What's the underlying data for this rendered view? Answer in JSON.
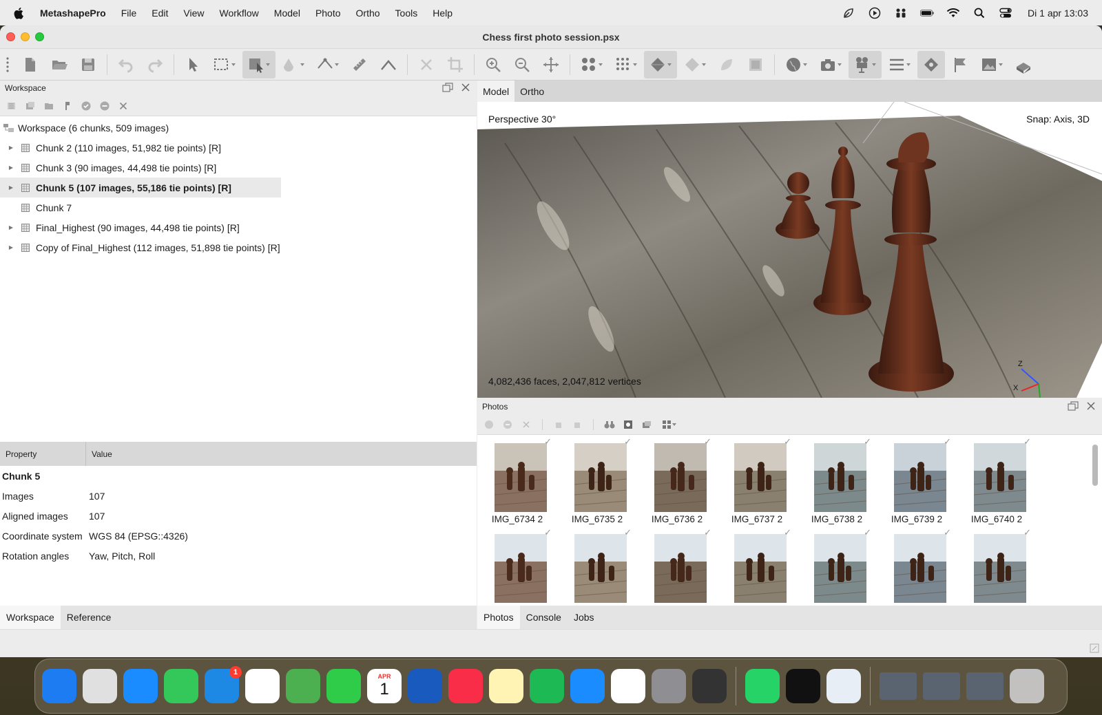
{
  "menubar": {
    "app": "MetashapePro",
    "items": [
      "File",
      "Edit",
      "View",
      "Workflow",
      "Model",
      "Photo",
      "Ortho",
      "Tools",
      "Help"
    ],
    "datetime": "Di 1 apr  13:03"
  },
  "window": {
    "title": "Chess first photo session.psx"
  },
  "workspace": {
    "panel_title": "Workspace",
    "root": "Workspace (6 chunks, 509 images)",
    "chunks": [
      {
        "label": "Chunk 2 (110 images, 51,982 tie points) [R]",
        "expandable": true,
        "selected": false
      },
      {
        "label": "Chunk 3 (90 images, 44,498 tie points) [R]",
        "expandable": true,
        "selected": false
      },
      {
        "label": "Chunk 5 (107 images, 55,186 tie points) [R]",
        "expandable": true,
        "selected": true
      },
      {
        "label": "Chunk 7",
        "expandable": false,
        "selected": false
      },
      {
        "label": "Final_Highest (90 images, 44,498 tie points) [R]",
        "expandable": true,
        "selected": false
      },
      {
        "label": "Copy of Final_Highest (112 images, 51,898 tie points) [R]",
        "expandable": true,
        "selected": false
      }
    ]
  },
  "properties": {
    "col_property": "Property",
    "col_value": "Value",
    "title": "Chunk 5",
    "rows": [
      {
        "k": "Images",
        "v": "107"
      },
      {
        "k": "Aligned images",
        "v": "107"
      },
      {
        "k": "Coordinate system",
        "v": "WGS 84 (EPSG::4326)"
      },
      {
        "k": "Rotation angles",
        "v": "Yaw, Pitch, Roll"
      }
    ]
  },
  "left_tabs": [
    {
      "label": "Workspace",
      "active": true
    },
    {
      "label": "Reference",
      "active": false
    }
  ],
  "view_tabs": [
    {
      "label": "Model",
      "active": true
    },
    {
      "label": "Ortho",
      "active": false
    }
  ],
  "viewport": {
    "perspective": "Perspective 30°",
    "snap": "Snap: Axis, 3D",
    "stats": "4,082,436 faces, 2,047,812 vertices",
    "axes": {
      "z": "Z",
      "x": "X",
      "y": "Y"
    }
  },
  "photos": {
    "panel_title": "Photos",
    "row1": [
      "IMG_6734 2",
      "IMG_6735 2",
      "IMG_6736 2",
      "IMG_6737 2",
      "IMG_6738 2",
      "IMG_6739 2",
      "IMG_6740 2"
    ],
    "row2_count": 7
  },
  "right_tabs": [
    {
      "label": "Photos",
      "active": true
    },
    {
      "label": "Console",
      "active": false
    },
    {
      "label": "Jobs",
      "active": false
    }
  ],
  "dock": {
    "apps": [
      "Finder",
      "Launchpad",
      "Safari",
      "Messages",
      "Mail",
      "Photos",
      "Maps",
      "FaceTime",
      "Calendar",
      "Word",
      "Music",
      "Notes",
      "Spotify",
      "App Store",
      "Chrome",
      "System Settings",
      "Metashape",
      "WhatsApp",
      "Shortcuts",
      "Preview"
    ],
    "mail_badge": "1",
    "calendar_month": "APR",
    "calendar_day": "1"
  }
}
